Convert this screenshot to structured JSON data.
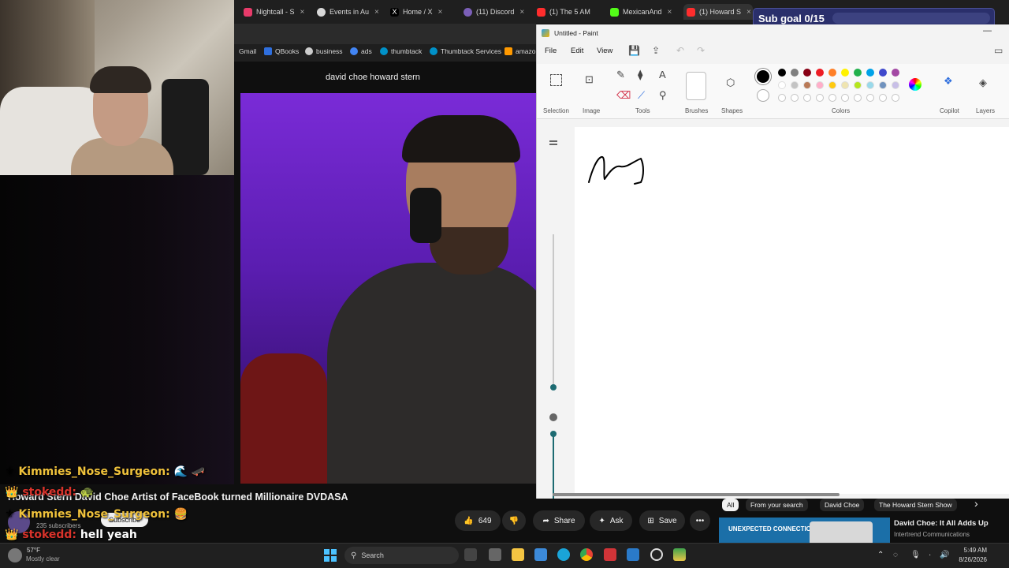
{
  "browser": {
    "tabs": [
      {
        "label": "Nightcall - S",
        "color": "#e83b6a"
      },
      {
        "label": "Events in Au",
        "color": "#d8d8d8"
      },
      {
        "label": "Home / X",
        "color": "#ffffff"
      },
      {
        "label": "(11) Discord",
        "color": "#7b5fb8"
      },
      {
        "label": "(1) The 5 AM",
        "color": "#ff2d2d"
      },
      {
        "label": "MexicanAnd",
        "color": "#53fc18"
      },
      {
        "label": "(1) Howard S",
        "color": "#ff2d2d"
      }
    ],
    "tab_close": "×",
    "bookmarks": [
      {
        "label": "Gmail",
        "color": "#ea4335"
      },
      {
        "label": "QBooks",
        "color": "#2f6fde"
      },
      {
        "label": "business",
        "color": "#cccccc"
      },
      {
        "label": "ads",
        "color": "#4285f4"
      },
      {
        "label": "thumbtack",
        "color": "#0091c8"
      },
      {
        "label": "Thumbtack Services",
        "color": "#0091c8"
      },
      {
        "label": "amazo",
        "color": "#ff9900"
      }
    ],
    "search_query": "david choe howard stern"
  },
  "sub_goal": {
    "label": "Sub goal 0/15",
    "progress": 0
  },
  "chat": [
    {
      "user": "Kimmies_Nose_Surgeon:",
      "message": "🌊 🛹"
    },
    {
      "user": "stokedd:",
      "message": "🐢"
    },
    {
      "user": "Kimmies_Nose_Surgeon:",
      "message": "🍔"
    },
    {
      "user": "stokedd:",
      "message": "hell yeah"
    }
  ],
  "youtube": {
    "video_title": "Howard Stern David Choe Artist of FaceBook turned Millionaire DVDASA",
    "subscribers": "235 subscribers",
    "subscribe_label": "Subscribe",
    "like_count": "649",
    "share_label": "Share",
    "ask_label": "Ask",
    "save_label": "Save",
    "more_label": "•••",
    "chips": [
      "All",
      "From your search",
      "David Choe",
      "The Howard Stern Show"
    ],
    "chip_next": "›",
    "ad_thumb_text": "UNEXPECTED CONNECTIONS",
    "ad_title": "David Choe: It All Adds Up",
    "ad_channel": "Intertrend Communications"
  },
  "paint": {
    "title": "Untitled - Paint",
    "minimize": "—",
    "menus": [
      "File",
      "Edit",
      "View"
    ],
    "groups": [
      "Selection",
      "Image",
      "Tools",
      "Brushes",
      "Shapes",
      "Colors",
      "Copilot",
      "Layers"
    ],
    "palette_row1": [
      "#000000",
      "#7f7f7f",
      "#880015",
      "#ed1c24",
      "#ff7f27",
      "#fff200",
      "#22b14c",
      "#00a2e8",
      "#3f48cc",
      "#a349a4"
    ],
    "palette_row2": [
      "#ffffff",
      "#c3c3c3",
      "#b97a57",
      "#ffaec9",
      "#ffc90e",
      "#efe4b0",
      "#b5e61d",
      "#99d9ea",
      "#7092be",
      "#c8bfe7"
    ],
    "primary_color": "#000000",
    "secondary_color": "#ffffff"
  },
  "taskbar": {
    "weather_temp": "57°F",
    "weather_desc": "Mostly clear",
    "search_label": "Search",
    "time": "5:49 AM",
    "date": "8/26/2026"
  }
}
